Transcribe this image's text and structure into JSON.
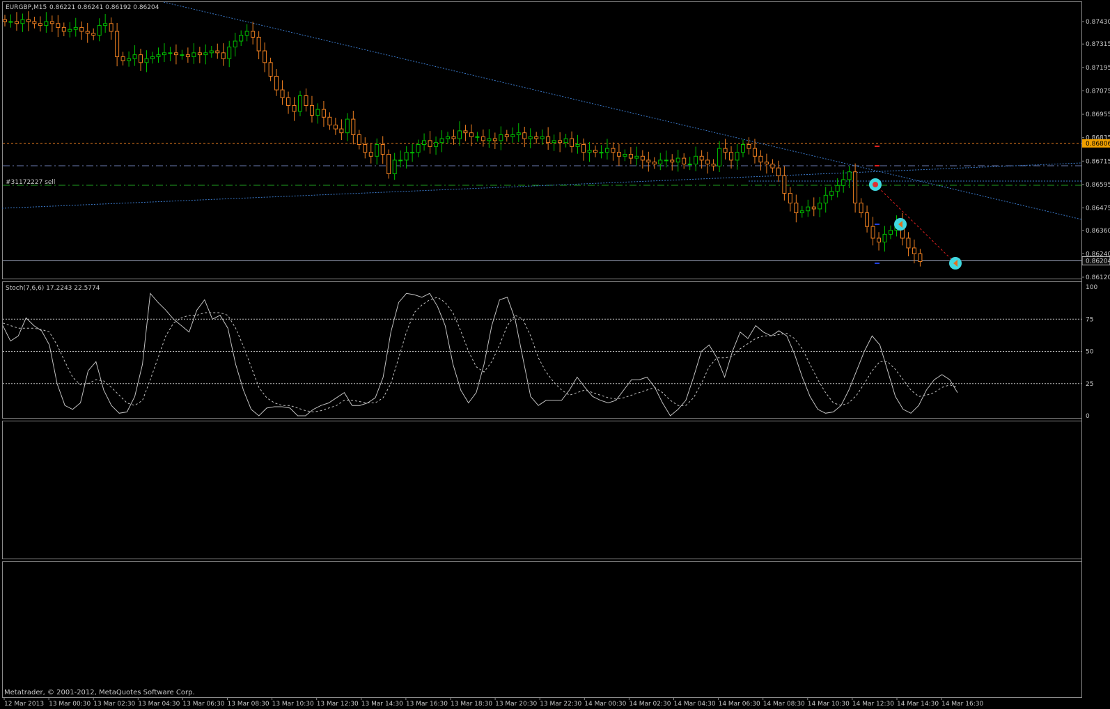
{
  "chart_header": {
    "symbol": "EURGBP,M15",
    "ohlc": "0.86221 0.86241 0.86192 0.86204"
  },
  "order_label": "#31172227 sell",
  "copyright": "Metatrader, © 2001-2012, MetaQuotes Software Corp.",
  "colors": {
    "background": "#000000",
    "bull_candle": "#00c000",
    "bear_candle": "#f08020",
    "trendline": "#3a78c8",
    "order_line": "#20a020",
    "level_orange": "#f08020",
    "stoch_main": "#c0c0c0",
    "stoch_signal": "#c0c0c0",
    "price_tag_orange": "#f0a000",
    "trade_marker": "#40d8e0"
  },
  "chart_data": [
    {
      "type": "candlestick",
      "title": "EURGBP,M15",
      "ylim": [
        0.8612,
        0.8749
      ],
      "y_ticks": [
        "0.87430",
        "0.87315",
        "0.87195",
        "0.87075",
        "0.86955",
        "0.86835",
        "0.86715",
        "0.86595",
        "0.86475",
        "0.86360",
        "0.86240",
        "0.86120"
      ],
      "y_tick_values": [
        0.8743,
        0.87315,
        0.87195,
        0.87075,
        0.86955,
        0.86835,
        0.86715,
        0.86595,
        0.86475,
        0.8636,
        0.8624,
        0.8612
      ],
      "price_tags": [
        {
          "value": 0.86806,
          "label": "0.86806",
          "style": "orange"
        },
        {
          "value": 0.86204,
          "label": "0.86204",
          "style": "current"
        }
      ],
      "x_ticks": [
        "12 Mar 2013",
        "13 Mar 00:30",
        "13 Mar 02:30",
        "13 Mar 04:30",
        "13 Mar 06:30",
        "13 Mar 08:30",
        "13 Mar 10:30",
        "13 Mar 12:30",
        "13 Mar 14:30",
        "13 Mar 16:30",
        "13 Mar 18:30",
        "13 Mar 20:30",
        "13 Mar 22:30",
        "14 Mar 00:30",
        "14 Mar 02:30",
        "14 Mar 04:30",
        "14 Mar 06:30",
        "14 Mar 08:30",
        "14 Mar 10:30",
        "14 Mar 12:30",
        "14 Mar 14:30",
        "14 Mar 16:30"
      ],
      "close": [
        0.8743,
        0.8743,
        0.8742,
        0.8744,
        0.8743,
        0.8742,
        0.8741,
        0.8743,
        0.8742,
        0.874,
        0.8738,
        0.8739,
        0.874,
        0.8738,
        0.8737,
        0.8736,
        0.8741,
        0.8742,
        0.8738,
        0.8725,
        0.8723,
        0.8724,
        0.8726,
        0.8722,
        0.8724,
        0.8725,
        0.8726,
        0.8727,
        0.8727,
        0.8726,
        0.8726,
        0.8725,
        0.8727,
        0.8726,
        0.8727,
        0.8728,
        0.8727,
        0.8724,
        0.873,
        0.8733,
        0.8736,
        0.8738,
        0.8735,
        0.8728,
        0.8722,
        0.8715,
        0.8708,
        0.8704,
        0.87,
        0.8697,
        0.8705,
        0.87,
        0.8695,
        0.8698,
        0.8694,
        0.869,
        0.8688,
        0.8686,
        0.8693,
        0.8685,
        0.868,
        0.8676,
        0.8674,
        0.868,
        0.8675,
        0.8665,
        0.8672,
        0.8672,
        0.8676,
        0.8676,
        0.868,
        0.8682,
        0.8679,
        0.8681,
        0.8683,
        0.8684,
        0.8683,
        0.8687,
        0.8686,
        0.8684,
        0.8684,
        0.8682,
        0.8683,
        0.8682,
        0.8685,
        0.8684,
        0.8685,
        0.8686,
        0.8683,
        0.8684,
        0.8683,
        0.8684,
        0.8681,
        0.8682,
        0.8681,
        0.8683,
        0.8679,
        0.868,
        0.8676,
        0.8677,
        0.8676,
        0.8676,
        0.8678,
        0.8676,
        0.8674,
        0.8675,
        0.8673,
        0.8674,
        0.8672,
        0.8671,
        0.867,
        0.8672,
        0.8672,
        0.8671,
        0.8673,
        0.867,
        0.867,
        0.8674,
        0.8672,
        0.867,
        0.8669,
        0.8678,
        0.8676,
        0.8672,
        0.8676,
        0.868,
        0.8678,
        0.8674,
        0.8671,
        0.867,
        0.8668,
        0.8664,
        0.8655,
        0.865,
        0.8645,
        0.8646,
        0.8648,
        0.8647,
        0.865,
        0.8654,
        0.8656,
        0.8659,
        0.8662,
        0.8666,
        0.865,
        0.8645,
        0.8638,
        0.8632,
        0.863,
        0.8634,
        0.8636,
        0.864,
        0.8632,
        0.8627,
        0.8624,
        0.862
      ]
    },
    {
      "type": "line",
      "title": "Stoch(7,6,6) 17.2243 22.5774",
      "ylim": [
        0,
        100
      ],
      "y_ticks": [
        "100",
        "75",
        "50",
        "25",
        "0"
      ],
      "y_tick_values": [
        100,
        75,
        50,
        25,
        0
      ],
      "levels": [
        75,
        50,
        25
      ],
      "series": [
        {
          "name": "Main",
          "style": "solid",
          "values": [
            70,
            58,
            62,
            76,
            70,
            66,
            55,
            25,
            8,
            5,
            10,
            35,
            42,
            20,
            8,
            2,
            3,
            15,
            40,
            95,
            88,
            82,
            75,
            70,
            65,
            82,
            90,
            75,
            78,
            68,
            40,
            20,
            5,
            0,
            6,
            7,
            7,
            6,
            0,
            0,
            5,
            8,
            10,
            14,
            18,
            8,
            8,
            10,
            14,
            30,
            65,
            88,
            95,
            94,
            92,
            95,
            85,
            70,
            40,
            20,
            10,
            18,
            40,
            70,
            90,
            92,
            75,
            45,
            15,
            8,
            12,
            12,
            12,
            20,
            30,
            22,
            15,
            12,
            10,
            12,
            20,
            28,
            28,
            30,
            22,
            10,
            0,
            5,
            12,
            30,
            50,
            55,
            45,
            30,
            50,
            65,
            60,
            70,
            65,
            62,
            66,
            62,
            48,
            30,
            15,
            5,
            2,
            3,
            8,
            20,
            35,
            50,
            62,
            55,
            35,
            15,
            5,
            2,
            8,
            20,
            28,
            32,
            28,
            18
          ]
        },
        {
          "name": "Signal",
          "style": "dashed",
          "values": [
            72,
            70,
            68,
            68,
            68,
            67,
            65,
            55,
            42,
            30,
            24,
            25,
            28,
            27,
            22,
            16,
            10,
            8,
            12,
            28,
            45,
            62,
            72,
            76,
            78,
            78,
            80,
            80,
            80,
            78,
            68,
            54,
            38,
            22,
            14,
            10,
            8,
            8,
            6,
            4,
            3,
            4,
            6,
            8,
            12,
            12,
            11,
            10,
            10,
            14,
            25,
            45,
            65,
            80,
            86,
            90,
            92,
            88,
            80,
            66,
            50,
            38,
            34,
            42,
            55,
            70,
            78,
            75,
            62,
            45,
            34,
            26,
            20,
            16,
            18,
            20,
            18,
            16,
            14,
            13,
            14,
            16,
            18,
            20,
            22,
            18,
            12,
            8,
            8,
            14,
            25,
            38,
            45,
            45,
            46,
            52,
            56,
            60,
            62,
            62,
            63,
            64,
            60,
            52,
            40,
            28,
            18,
            10,
            8,
            10,
            16,
            25,
            35,
            42,
            42,
            36,
            28,
            20,
            15,
            16,
            18,
            22,
            24,
            22
          ]
        }
      ]
    }
  ]
}
